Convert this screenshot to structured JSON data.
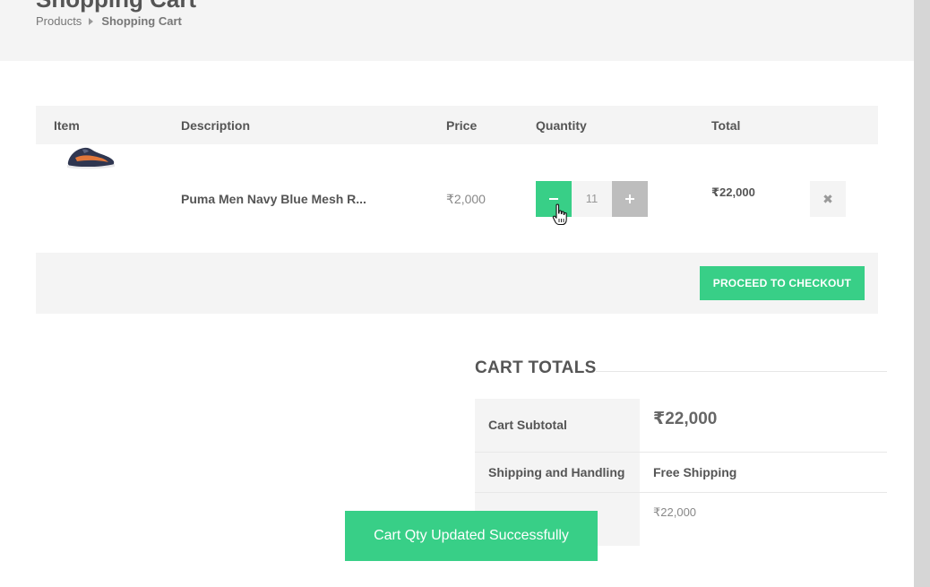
{
  "header": {
    "title": "Shopping Cart",
    "breadcrumb": {
      "parent": "Products",
      "current": "Shopping Cart"
    }
  },
  "table": {
    "columns": {
      "item": "Item",
      "description": "Description",
      "price": "Price",
      "quantity": "Quantity",
      "total": "Total"
    },
    "rows": [
      {
        "description": "Puma Men Navy Blue Mesh R...",
        "price": "₹2,000",
        "quantity": "11",
        "total": "₹22,000",
        "remove_symbol": "✖"
      }
    ]
  },
  "checkout_button": "PROCEED TO CHECKOUT",
  "totals": {
    "title": "CART TOTALS",
    "subtotal_label": "Cart Subtotal",
    "subtotal_value": "₹22,000",
    "shipping_label": "Shipping and Handling",
    "shipping_value": "Free Shipping",
    "order_total_value": "₹22,000"
  },
  "toast": "Cart Qty Updated Successfully",
  "colors": {
    "accent": "#38cf87",
    "panel": "#f4f4f4",
    "button_gray": "#bdbdbd"
  },
  "icons": {
    "breadcrumb_separator": "caret-right-icon",
    "remove": "close-icon",
    "cursor": "hand-pointer-icon",
    "product": "shoe-thumbnail"
  }
}
